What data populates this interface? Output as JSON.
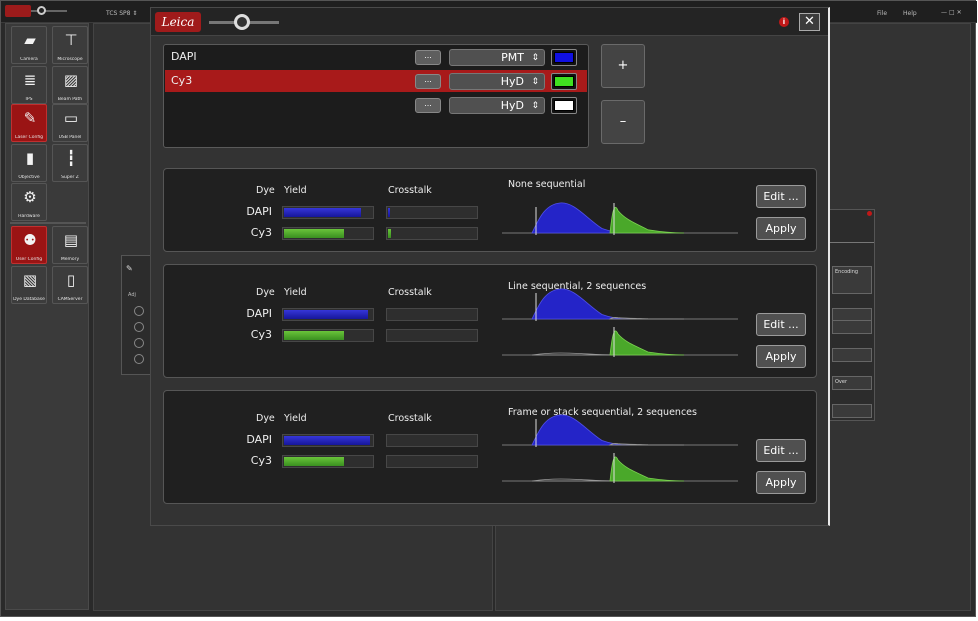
{
  "topbar": {
    "instrument": "TCS SP8 ⇕",
    "menu_file": "File",
    "menu_help": "Help",
    "window_controls": "—□✕"
  },
  "sidebar": {
    "tiles": [
      {
        "label": "Camera",
        "icon": "camera-icon",
        "glyph": "▰",
        "active": false
      },
      {
        "label": "Microscope",
        "icon": "microscope-icon",
        "glyph": "⊤",
        "active": false
      },
      {
        "label": "IPS",
        "icon": "ips-icon",
        "glyph": "≣",
        "active": false
      },
      {
        "label": "Beam Path",
        "icon": "beam-path-icon",
        "glyph": "▨",
        "active": false
      },
      {
        "label": "Laser Config",
        "icon": "laser-config-icon",
        "glyph": "✎",
        "active": true
      },
      {
        "label": "USB Panel",
        "icon": "usb-panel-icon",
        "glyph": "▭",
        "active": false
      },
      {
        "label": "Objective",
        "icon": "objective-icon",
        "glyph": "▮",
        "active": false
      },
      {
        "label": "Super Z",
        "icon": "super-z-icon",
        "glyph": "┇",
        "active": false
      },
      {
        "label": "Hardware",
        "icon": "hardware-gear-icon",
        "glyph": "⚙",
        "active": false
      },
      {
        "label": "User Config",
        "icon": "user-config-icon",
        "glyph": "⚉",
        "active": true
      },
      {
        "label": "Memory",
        "icon": "memory-icon",
        "glyph": "▤",
        "active": false
      },
      {
        "label": "Dye Database",
        "icon": "dye-database-icon",
        "glyph": "▧",
        "active": false
      },
      {
        "label": "CAMServer",
        "icon": "camserver-icon",
        "glyph": "▯",
        "active": false
      }
    ]
  },
  "background": {
    "left_panel_tab": "Adj",
    "right_panel": {
      "label_1": "Encoding",
      "label_2": "Over"
    }
  },
  "dialog": {
    "buttons": {
      "add": "+",
      "remove": "–",
      "close": "✕",
      "info": "i"
    },
    "dyes": [
      {
        "name": "DAPI",
        "options": "...",
        "detector": "PMT",
        "color": "#1010e0",
        "selected": false
      },
      {
        "name": "Cy3",
        "options": "...",
        "detector": "HyD",
        "color": "#40e020",
        "selected": true
      },
      {
        "name": "",
        "options": "...",
        "detector": "HyD",
        "color": "#ffffff",
        "selected": false
      }
    ],
    "seq_headers": {
      "dye": "Dye",
      "yield": "Yield",
      "crosstalk": "Crosstalk"
    },
    "panels": [
      {
        "mode": "None sequential",
        "rows": [
          {
            "dye": "DAPI",
            "yield": 0.88,
            "crosstalk": 0.01,
            "series": "blue"
          },
          {
            "dye": "Cy3",
            "yield": 0.68,
            "crosstalk": 0.03,
            "series": "green"
          }
        ],
        "sequences": 1,
        "edit_label": "Edit ...",
        "apply_label": "Apply"
      },
      {
        "mode": "Line sequential, 2 sequences",
        "rows": [
          {
            "dye": "DAPI",
            "yield": 0.96,
            "crosstalk": 0,
            "series": "blue"
          },
          {
            "dye": "Cy3",
            "yield": 0.68,
            "crosstalk": 0,
            "series": "green"
          }
        ],
        "sequences": 2,
        "edit_label": "Edit ...",
        "apply_label": "Apply"
      },
      {
        "mode": "Frame or stack sequential, 2 sequences",
        "rows": [
          {
            "dye": "DAPI",
            "yield": 0.98,
            "crosstalk": 0,
            "series": "blue"
          },
          {
            "dye": "Cy3",
            "yield": 0.68,
            "crosstalk": 0,
            "series": "green"
          }
        ],
        "sequences": 2,
        "edit_label": "Edit ...",
        "apply_label": "Apply"
      }
    ]
  }
}
